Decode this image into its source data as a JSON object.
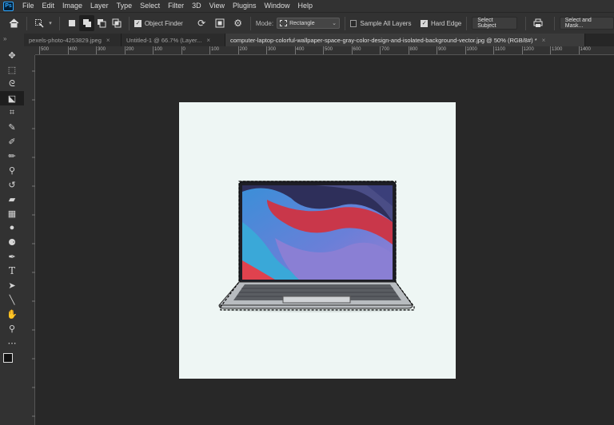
{
  "menubar": {
    "logo": "Ps",
    "items": [
      "File",
      "Edit",
      "Image",
      "Layer",
      "Type",
      "Select",
      "Filter",
      "3D",
      "View",
      "Plugins",
      "Window",
      "Help"
    ]
  },
  "options": {
    "object_finder_label": "Object Finder",
    "mode_label": "Mode:",
    "mode_value": "Rectangle",
    "sample_all_layers_label": "Sample All Layers",
    "hard_edge_label": "Hard Edge",
    "select_subject_label": "Select Subject",
    "select_and_mask_label": "Select and Mask...",
    "object_finder_checked": true,
    "sample_all_layers_checked": false,
    "hard_edge_checked": true
  },
  "tabs": [
    {
      "label": "pexels-photo-4253829.jpeg",
      "active": false
    },
    {
      "label": "Untitled-1 @ 66.7% (Layer...",
      "active": false
    },
    {
      "label": "computer-laptop-colorful-wallpaper-space-gray-color-design-and-isolated-background-vector.jpg @ 50% (RGB/8#) *",
      "active": true
    }
  ],
  "ruler": {
    "labels": [
      "500",
      "400",
      "300",
      "200",
      "100",
      "0",
      "100",
      "200",
      "300",
      "400",
      "500",
      "600",
      "700",
      "800",
      "900",
      "1000",
      "1100",
      "1200",
      "1300",
      "1400"
    ]
  },
  "tools": [
    {
      "name": "move-tool",
      "icon": "move-icon",
      "glyph": "✥"
    },
    {
      "name": "marquee-tool",
      "icon": "marquee-icon",
      "glyph": "⬚"
    },
    {
      "name": "lasso-tool",
      "icon": "lasso-icon",
      "glyph": "ᘓ"
    },
    {
      "name": "object-selection-tool",
      "icon": "object-selection-icon",
      "glyph": "⬕",
      "active": true
    },
    {
      "name": "crop-tool",
      "icon": "crop-icon",
      "glyph": "⌗"
    },
    {
      "name": "eyedropper-tool",
      "icon": "eyedropper-icon",
      "glyph": "✎"
    },
    {
      "name": "spot-healing-tool",
      "icon": "healing-icon",
      "glyph": "✐"
    },
    {
      "name": "brush-tool",
      "icon": "brush-icon",
      "glyph": "✏"
    },
    {
      "name": "clone-stamp-tool",
      "icon": "clone-stamp-icon",
      "glyph": "⚲"
    },
    {
      "name": "history-brush-tool",
      "icon": "history-brush-icon",
      "glyph": "↺"
    },
    {
      "name": "eraser-tool",
      "icon": "eraser-icon",
      "glyph": "▰"
    },
    {
      "name": "gradient-tool",
      "icon": "gradient-icon",
      "glyph": "▦"
    },
    {
      "name": "blur-tool",
      "icon": "blur-icon",
      "glyph": "●"
    },
    {
      "name": "dodge-tool",
      "icon": "dodge-icon",
      "glyph": "⚈"
    },
    {
      "name": "pen-tool",
      "icon": "pen-icon",
      "glyph": "✒"
    },
    {
      "name": "type-tool",
      "icon": "type-icon",
      "glyph": "T"
    },
    {
      "name": "path-selection-tool",
      "icon": "path-selection-icon",
      "glyph": "➤"
    },
    {
      "name": "line-tool",
      "icon": "line-icon",
      "glyph": "╲"
    },
    {
      "name": "hand-tool",
      "icon": "hand-icon",
      "glyph": "✋"
    },
    {
      "name": "zoom-tool",
      "icon": "zoom-icon",
      "glyph": "⚲"
    },
    {
      "name": "more-tools",
      "icon": "more-icon",
      "glyph": "⋯"
    }
  ],
  "colors": {
    "accent": "#31a8ff",
    "canvas_bg": "#eef6f4",
    "workspace": "#282828"
  }
}
